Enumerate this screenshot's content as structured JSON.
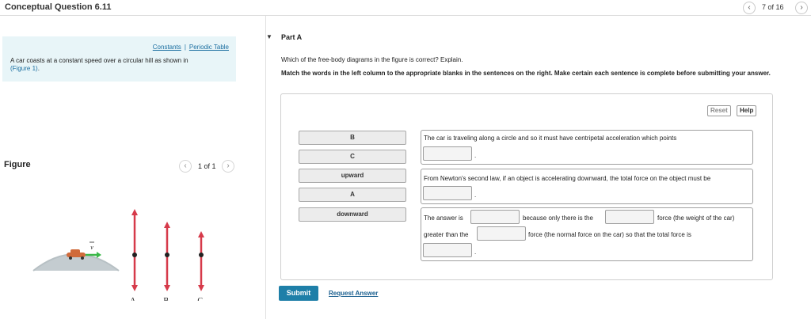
{
  "header": {
    "title": "Conceptual Question 6.11",
    "prev_icon": "chevron-left-icon",
    "next_icon": "chevron-right-icon",
    "prev_glyph": "‹",
    "next_glyph": "›",
    "position": "7 of 16"
  },
  "problem": {
    "constants_link": "Constants",
    "separator": "|",
    "periodic_link": "Periodic Table",
    "text": "A car coasts at a constant speed over a circular hill as shown in",
    "figure_link": "(Figure 1)",
    "after_link": "."
  },
  "figure": {
    "label": "Figure",
    "position": "1 of 1",
    "velocity_label": "v",
    "diagram_labels": [
      "A.",
      "B.",
      "C."
    ],
    "arrow_color": "#d63a4a",
    "velocity_color": "#3cb84a"
  },
  "part": {
    "toggle": "▼",
    "title": "Part A",
    "question": "Which of the free-body diagrams in the figure is correct? Explain.",
    "instructions": "Match the words in the left column to the appropriate blanks in the sentences on the right. Make certain each sentence is complete before submitting your answer."
  },
  "toolbar": {
    "reset": "Reset",
    "help": "Help"
  },
  "word_bank": [
    "B",
    "C",
    "upward",
    "A",
    "downward"
  ],
  "sentences": {
    "s1": "The car is traveling along a circle and so it must have centripetal acceleration which points",
    "s2": "From Newton's second law, if an object is accelerating downward, the total force on the object must be",
    "s3a": "The answer is",
    "s3b": "because only there is the",
    "s3c": "force (the weight of the car)",
    "s3d": "greater than the",
    "s3e": "force (the normal force on the car) so that the total force is",
    "period": "."
  },
  "footer": {
    "submit": "Submit",
    "request": "Request Answer"
  },
  "colors": {
    "accent": "#1e7fa8",
    "link": "#1a6ea0",
    "problem_bg": "#e8f5f8"
  }
}
